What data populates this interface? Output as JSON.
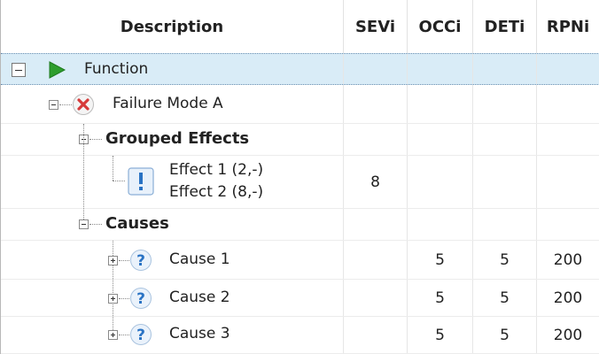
{
  "columns": {
    "description": "Description",
    "sev": "SEVi",
    "occ": "OCCi",
    "det": "DETi",
    "rpn": "RPNi"
  },
  "rows": {
    "function": {
      "label": "Function"
    },
    "failure_mode": {
      "label": "Failure Mode A"
    },
    "grouped_effects": {
      "label": "Grouped Effects"
    },
    "effects": {
      "line1": "Effect 1 (2,-)",
      "line2": "Effect 2 (8,-)",
      "sev": "8"
    },
    "causes": {
      "label": "Causes"
    },
    "cause_items": [
      {
        "label": "Cause 1",
        "occ": "5",
        "det": "5",
        "rpn": "200"
      },
      {
        "label": "Cause 2",
        "occ": "5",
        "det": "5",
        "rpn": "200"
      },
      {
        "label": "Cause 3",
        "occ": "5",
        "det": "5",
        "rpn": "200"
      }
    ]
  },
  "icons": {
    "function": "play-icon",
    "failure_mode": "x-circle-icon",
    "effect": "exclamation-icon",
    "cause": "question-icon"
  },
  "colors": {
    "selection": "#d9ecf7",
    "play_green": "#2e9e2e",
    "fail_red": "#d63a3a",
    "info_blue": "#2a73c4"
  }
}
